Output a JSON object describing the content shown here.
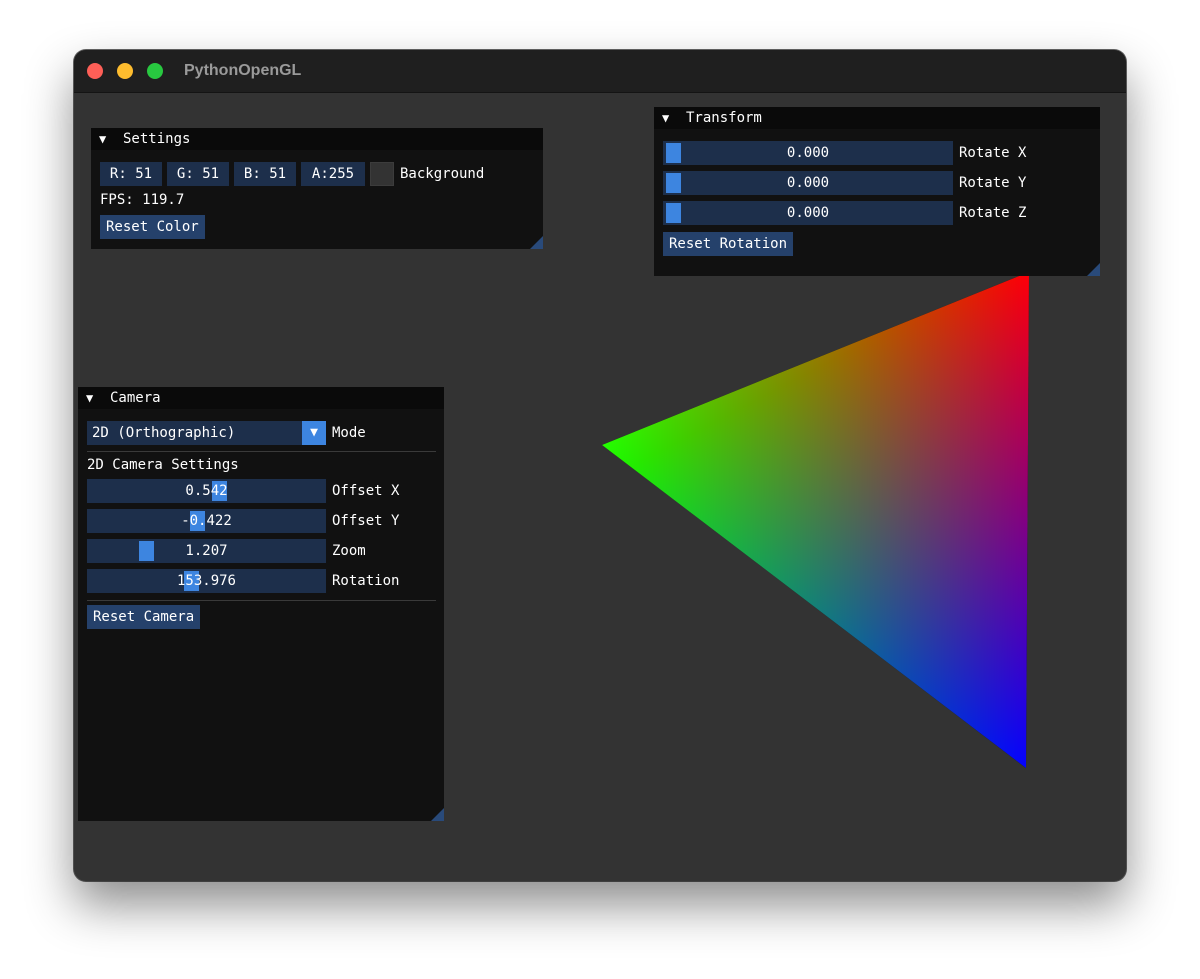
{
  "window": {
    "title": "PythonOpenGL",
    "background_color": "#333333"
  },
  "settings": {
    "title": "Settings",
    "r_label": "R: 51",
    "g_label": "G: 51",
    "b_label": "B: 51",
    "a_label": "A:255",
    "background_label": "Background",
    "swatch_color": "#333333",
    "fps_label": "FPS: 119.7",
    "reset_label": "Reset Color"
  },
  "transform": {
    "title": "Transform",
    "rotate_x": {
      "value": "0.000",
      "label": "Rotate X"
    },
    "rotate_y": {
      "value": "0.000",
      "label": "Rotate Y"
    },
    "rotate_z": {
      "value": "0.000",
      "label": "Rotate Z"
    },
    "reset_label": "Reset Rotation"
  },
  "camera": {
    "title": "Camera",
    "mode_value": "2D (Orthographic)",
    "mode_label": "Mode",
    "section_label": "2D Camera Settings",
    "offset_x": {
      "value": "0.542",
      "label": "Offset X"
    },
    "offset_y": {
      "value": "-0.422",
      "label": "Offset Y"
    },
    "zoom": {
      "value": "1.207",
      "label": "Zoom"
    },
    "rotation": {
      "value": "153.976",
      "label": "Rotation"
    },
    "reset_label": "Reset Camera"
  },
  "triangle": {
    "colors": [
      "#ff0000",
      "#00ff00",
      "#0000ff"
    ]
  },
  "theme": {
    "accent": "#3d85e0",
    "frame_bg": "#1d2f4b",
    "button_bg": "#25416b"
  }
}
